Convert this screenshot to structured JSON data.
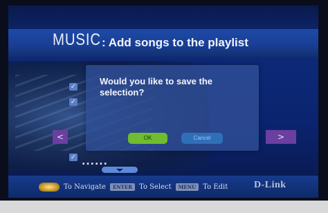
{
  "header": {
    "title": "MUSIC",
    "subtitle": ": Add songs to the playlist"
  },
  "list": {
    "partial_item_text": "......"
  },
  "dialog": {
    "message": "Would you like to save the selection?",
    "ok_label": "OK",
    "cancel_label": "Cancel"
  },
  "navigation": {
    "left_arrow": "<",
    "right_arrow": ">"
  },
  "footer": {
    "navigate_text": "To Navigate",
    "enter_key": "ENTER",
    "select_text": "To Select",
    "menu_key": "MENU",
    "edit_text": "To Edit",
    "brand": "D-Link"
  },
  "icons": {
    "checkbox": "check-icon",
    "navpad": "navigation-pad-icon",
    "scroll": "scroll-down-icon"
  },
  "colors": {
    "ok_button": "#6fbd2e",
    "cancel_button": "#2f6fb8",
    "nav_arrow": "#6a3fa0"
  }
}
